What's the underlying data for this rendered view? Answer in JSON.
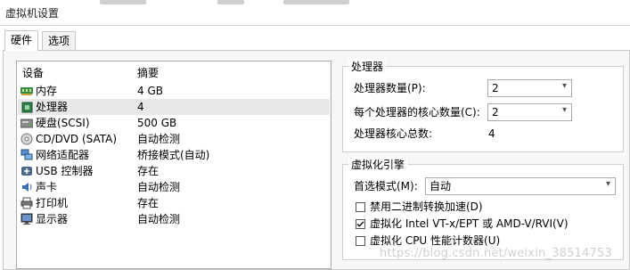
{
  "window": {
    "title": "虚拟机设置"
  },
  "tabs": [
    {
      "label": "硬件"
    },
    {
      "label": "选项"
    }
  ],
  "devices": {
    "header": {
      "device": "设备",
      "summary": "摘要"
    },
    "items": [
      {
        "name": "内存",
        "summary": "4 GB",
        "icon": "memory-icon"
      },
      {
        "name": "处理器",
        "summary": "4",
        "icon": "processor-icon"
      },
      {
        "name": "硬盘(SCSI)",
        "summary": "500 GB",
        "icon": "hard-disk-icon"
      },
      {
        "name": "CD/DVD (SATA)",
        "summary": "自动检测",
        "icon": "cd-dvd-icon"
      },
      {
        "name": "网络适配器",
        "summary": "桥接模式(自动)",
        "icon": "network-adapter-icon"
      },
      {
        "name": "USB 控制器",
        "summary": "存在",
        "icon": "usb-icon"
      },
      {
        "name": "声卡",
        "summary": "自动检测",
        "icon": "sound-card-icon"
      },
      {
        "name": "打印机",
        "summary": "存在",
        "icon": "printer-icon"
      },
      {
        "name": "显示器",
        "summary": "自动检测",
        "icon": "display-icon"
      }
    ],
    "selected_item": "处理器"
  },
  "processor": {
    "legend": "处理器",
    "count_label": "处理器数量(P):",
    "count_value": "2",
    "cores_label": "每个处理器的核心数量(C):",
    "cores_value": "2",
    "total_label": "处理器核心总数:",
    "total_value": "4"
  },
  "virtualization": {
    "legend": "虚拟化引擎",
    "mode_label": "首选模式(M):",
    "mode_value": "自动",
    "options": [
      {
        "label": "禁用二进制转换加速(D)",
        "checked": false
      },
      {
        "label": "虚拟化 Intel VT-x/EPT 或 AMD-V/RVI(V)",
        "checked": true
      },
      {
        "label": "虚拟化 CPU 性能计数器(U)",
        "checked": false
      }
    ]
  },
  "watermark": "https://blog.csdn.net/weixin_38514753",
  "colors": {
    "selected_row": "#e8e8e8",
    "panel_border": "#a9a9a9"
  }
}
